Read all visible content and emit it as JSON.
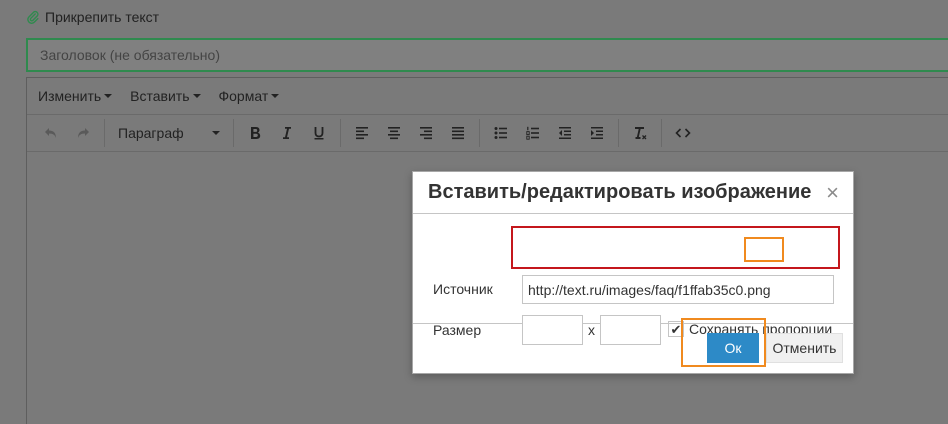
{
  "attach_text": "Прикрепить текст",
  "title_field": {
    "placeholder": "Заголовок (не обязательно)"
  },
  "menubar": {
    "edit": "Изменить",
    "insert": "Вставить",
    "format": "Формат"
  },
  "toolbar": {
    "block_format": "Параграф"
  },
  "dialog": {
    "title": "Вставить/редактировать изображение",
    "close_symbol": "×",
    "source_label": "Источник",
    "source_value": "http://text.ru/images/faq/f1ffab35c0.png",
    "size_label": "Размер",
    "size_separator": "x",
    "constrain_label": "Сохранять пропорции",
    "constrain_checked": true,
    "ok_label": "Ок",
    "cancel_label": "Отменить"
  },
  "colors": {
    "accent_green": "#2f8a4e",
    "highlight_red": "#c4171c",
    "highlight_orange": "#f08a1f",
    "primary_button": "#2d8ac7"
  }
}
